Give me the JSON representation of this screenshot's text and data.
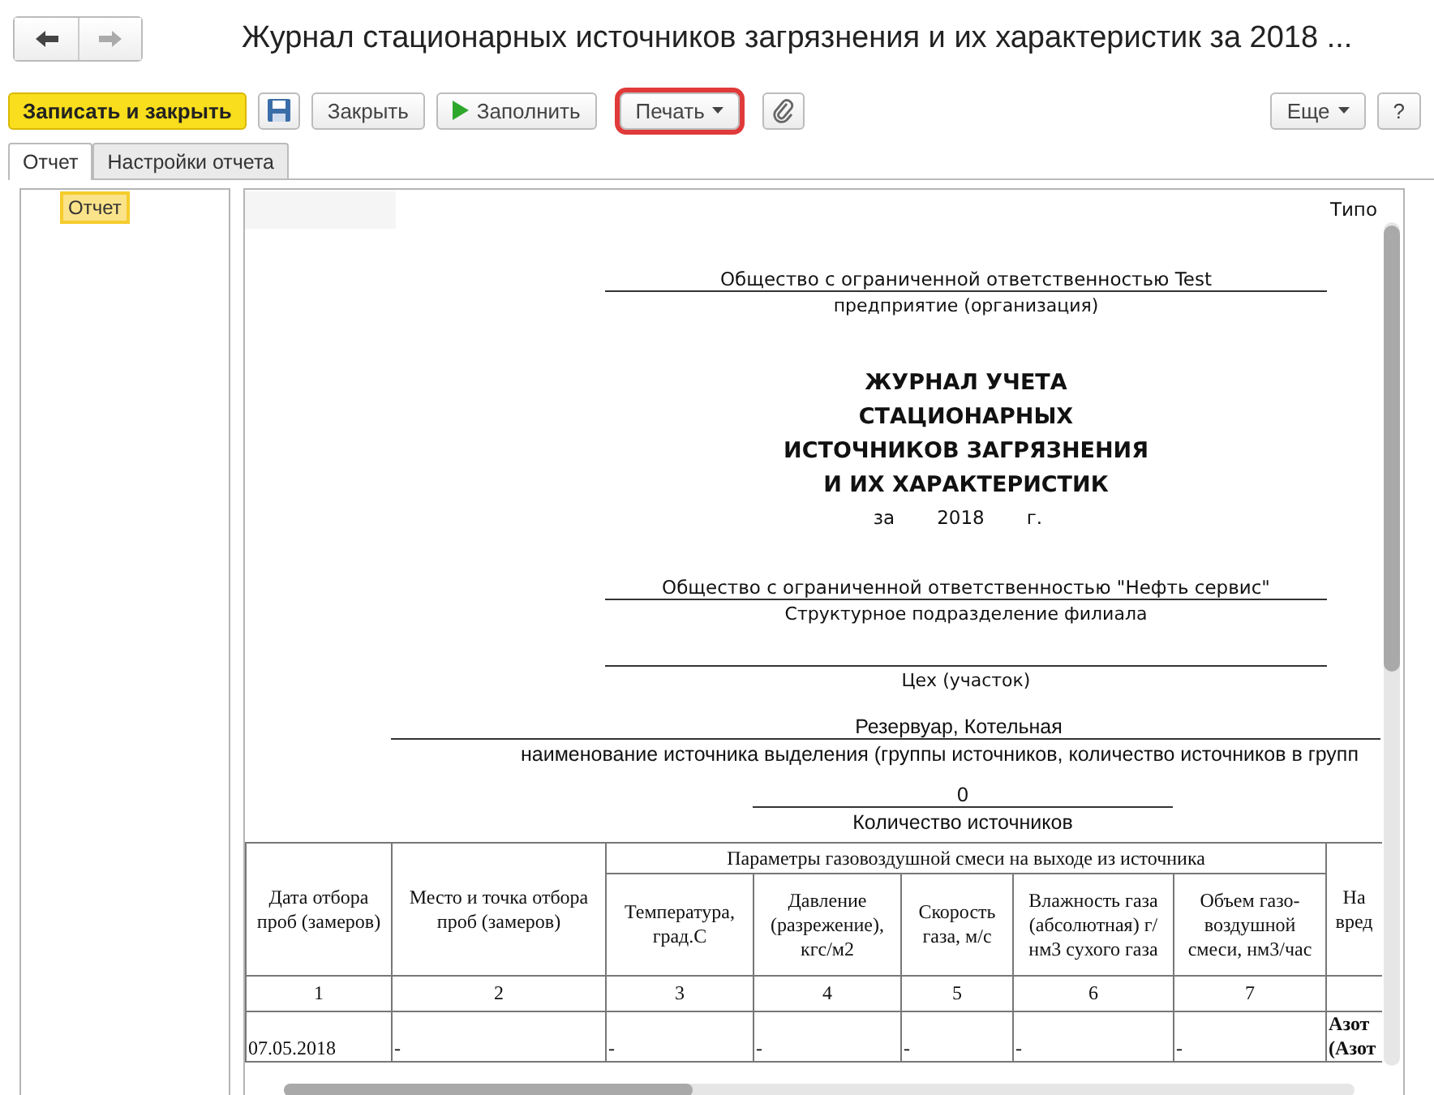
{
  "window": {
    "title": "Журнал стационарных источников загрязнения и их характеристик за 2018 ..."
  },
  "toolbar": [
    {
      "kind": "primary",
      "label": "Записать и закрыть"
    },
    {
      "kind": "save"
    },
    {
      "kind": "plain",
      "label": "Закрыть"
    },
    {
      "kind": "play",
      "label": "Заполнить"
    },
    {
      "kind": "dropdown",
      "label": "Печать",
      "highlighted": true
    },
    {
      "kind": "attach"
    },
    {
      "kind": "spacer"
    },
    {
      "kind": "dropdown",
      "label": "Еще",
      "highlighted": false
    },
    {
      "kind": "plain",
      "label": "?"
    }
  ],
  "tabs": [
    {
      "label": "Отчет",
      "selected": true
    },
    {
      "label": "Настройки отчета",
      "selected": false
    }
  ],
  "sidebar": {
    "items": [
      {
        "label": "Отчет",
        "selected": true
      }
    ]
  },
  "report": {
    "corner_text": "Типо",
    "organization": {
      "value": "Общество с ограниченной ответственностью Test",
      "caption": "предприятие (организация)"
    },
    "title_lines": [
      "ЖУРНАЛ УЧЕТА",
      "СТАЦИОНАРНЫХ",
      "ИСТОЧНИКОВ ЗАГРЯЗНЕНИЯ",
      "И ИХ ХАРАКТЕРИСТИК"
    ],
    "year": {
      "prefix": "за",
      "value": "2018",
      "suffix": "г."
    },
    "fields": [
      {
        "kind": "normal",
        "value": "Общество с ограниченной ответственностью \"Нефть сервис\"",
        "caption": "Структурное подразделение филиала"
      },
      {
        "kind": "normal",
        "caption": "Цех (участок)"
      },
      {
        "kind": "wide",
        "value": "Резервуар, Котельная",
        "caption": "наименование источника выделения (группы источников, количество источников в групп"
      },
      {
        "kind": "short",
        "value": "0",
        "caption": "Количество источников"
      }
    ],
    "table": {
      "group_header": "Параметры газовоздушной смеси на выходе из источника",
      "columns": [
        {
          "label": "Дата отбора проб (замеров)",
          "number": "1"
        },
        {
          "label": "Место и точка отбора проб (замеров)",
          "number": "2"
        },
        {
          "label": "Температура, град.С",
          "number": "3",
          "group": true
        },
        {
          "label": "Давление (разрежение), кгс/м2",
          "number": "4",
          "group": true
        },
        {
          "label": "Скорость газа, м/с",
          "number": "5",
          "group": true
        },
        {
          "label": "Влажность газа (абсолютная) г/нм3 сухого газа",
          "number": "6",
          "group": true
        },
        {
          "label": "Объем газо-воздушной смеси, нм3/час",
          "number": "7",
          "group": true
        },
        {
          "label": "На вред"
        }
      ],
      "rows": [
        [
          "07.05.2018",
          "-",
          "-",
          "-",
          "-",
          "-",
          "-",
          "Азот (Азот"
        ]
      ]
    }
  }
}
